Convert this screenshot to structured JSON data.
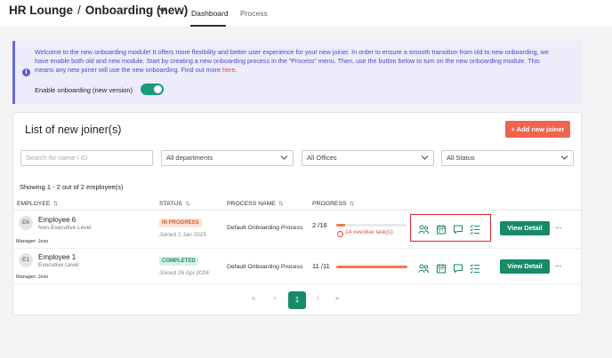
{
  "header": {
    "app": "HR Lounge",
    "separator": "/",
    "title": "Onboarding (new)",
    "tabs": [
      {
        "label": "Dashboard",
        "active": true
      },
      {
        "label": "Process",
        "active": false
      }
    ]
  },
  "banner": {
    "text_before_link": "Welcome to the new onboarding module! It offers more flexibility and better user experience for your new joiner. In order to ensure a smooth transition from old to new onboarding, we have enable both old and new module. Start by creating a new onboarding process in the \"Process\" menu. Then, use the button below to turn on the new onboarding module. This means any new joiner will use the new onboarding. Find out more ",
    "link_text": "here",
    "text_after_link": ".",
    "toggle_label": "Enable onboarding (new version)",
    "toggle_on": true
  },
  "list": {
    "title": "List of new joiner(s)",
    "add_button": "+ Add new joiner",
    "filters": {
      "search_placeholder": "Search for name / ID",
      "department": "All departments",
      "office": "All Offices",
      "status": "All Status"
    },
    "showing": "Showing 1 - 2 out of 2 employee(s)",
    "columns": [
      "EMPLOYEE",
      "STATUS",
      "PROCESS NAME",
      "PROGRESS"
    ],
    "rows": [
      {
        "initials": "E6",
        "name": "Employee 6",
        "level": "Non-Executive Level",
        "manager": "Manager: Jess",
        "status": "IN PROGRESS",
        "joined": "Joined 1 Jan 2025",
        "process": "Default Onboarding Process",
        "progress": "2 /16",
        "progress_fraction": 0.125,
        "overdue": "14 overdue task(s)",
        "action": "View Detail",
        "more": "..."
      },
      {
        "initials": "E1",
        "name": "Employee 1",
        "level": "Executive Level",
        "manager": "Manager: Jess",
        "status": "COMPLETED",
        "joined": "Joined 26 Apr 2024",
        "process": "Default Onboarding Process",
        "progress": "11 /11",
        "progress_fraction": 1.0,
        "overdue": "",
        "action": "View Detail",
        "more": "..."
      }
    ],
    "row_icons": [
      "people-icon",
      "calendar-icon",
      "comment-icon",
      "checklist-icon"
    ],
    "pagination": {
      "first": "«",
      "prev": "‹",
      "current": "1",
      "next": "›",
      "last": "»"
    }
  },
  "colors": {
    "accent": "#178a68",
    "add_button": "#f0644f",
    "banner_bg": "#ececfb",
    "banner_text": "#4a4ac8",
    "highlight": "#e0222a"
  }
}
